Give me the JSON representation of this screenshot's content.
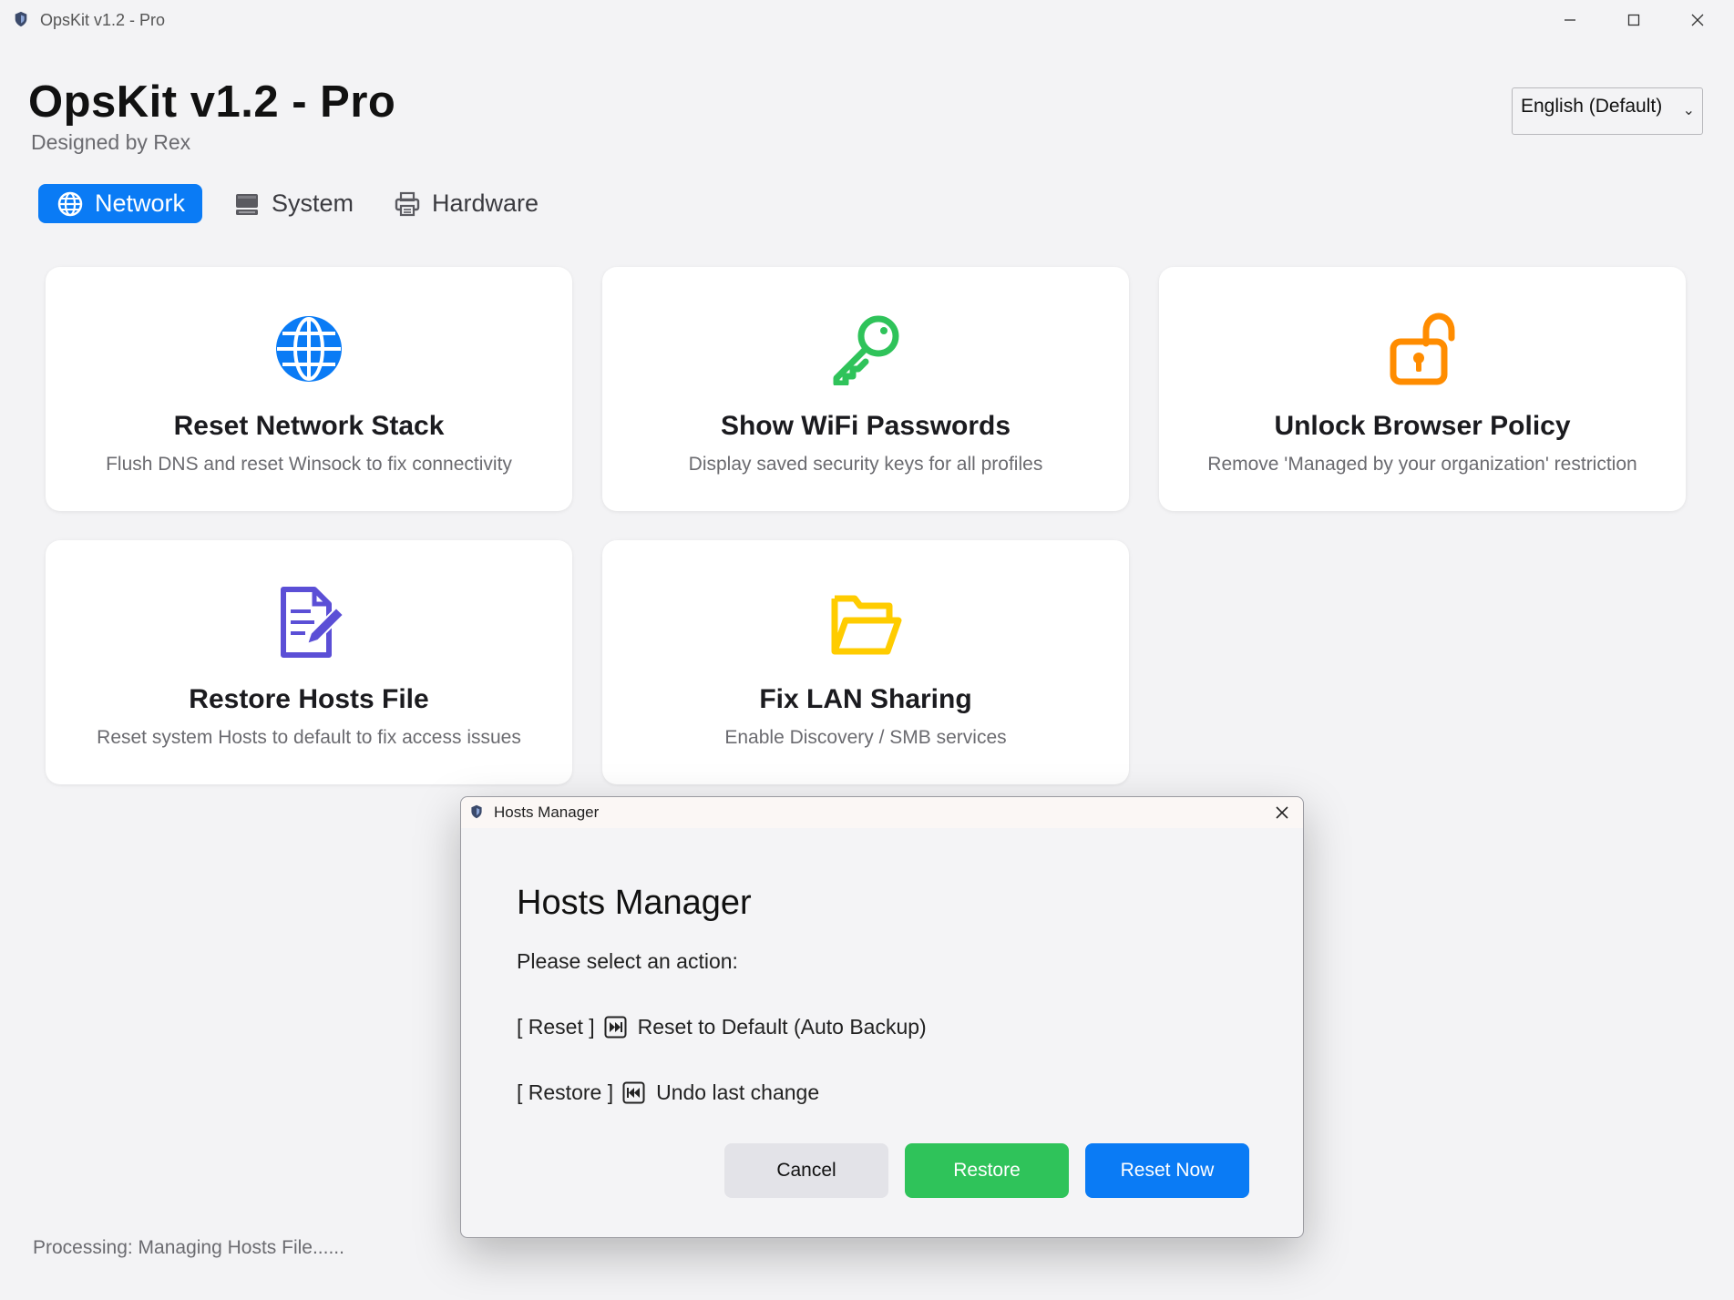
{
  "window": {
    "title": "OpsKit v1.2 - Pro",
    "icon": "shield-icon"
  },
  "header": {
    "title": "OpsKit v1.2 - Pro",
    "subtitle": "Designed by Rex"
  },
  "language": {
    "selected": "English (Default)"
  },
  "tabs": [
    {
      "label": "Network",
      "icon": "globe-icon",
      "active": true
    },
    {
      "label": "System",
      "icon": "computer-icon",
      "active": false
    },
    {
      "label": "Hardware",
      "icon": "printer-icon",
      "active": false
    }
  ],
  "cards": [
    {
      "title": "Reset Network Stack",
      "desc": "Flush DNS and reset Winsock to fix connectivity",
      "icon": "globe-icon",
      "color": "#0a7bf5"
    },
    {
      "title": "Show WiFi Passwords",
      "desc": "Display saved security keys for all profiles",
      "icon": "key-icon",
      "color": "#2fc35a"
    },
    {
      "title": "Unlock Browser Policy",
      "desc": "Remove 'Managed by your organization' restriction",
      "icon": "unlock-icon",
      "color": "#ff8c00"
    },
    {
      "title": "Restore Hosts File",
      "desc": "Reset system Hosts to default to fix access issues",
      "icon": "document-edit-icon",
      "color": "#5b4fd6"
    },
    {
      "title": "Fix LAN Sharing",
      "desc": "Enable Discovery / SMB services",
      "icon": "folder-icon",
      "color": "#ffcc00"
    }
  ],
  "status": {
    "text": "Processing: Managing Hosts File......"
  },
  "dialog": {
    "window_title": "Hosts Manager",
    "heading": "Hosts Manager",
    "prompt": "Please select an action:",
    "option_reset_tag": "[ Reset ]",
    "option_reset_text": "Reset to Default (Auto Backup)",
    "option_restore_tag": "[ Restore ]",
    "option_restore_text": "Undo last change",
    "cancel_label": "Cancel",
    "restore_label": "Restore",
    "reset_label": "Reset Now"
  },
  "colors": {
    "accent_blue": "#0a7bf5",
    "accent_green": "#2fc35a",
    "accent_orange": "#ff8c00",
    "accent_purple": "#5b4fd6",
    "accent_yellow": "#ffcc00"
  }
}
